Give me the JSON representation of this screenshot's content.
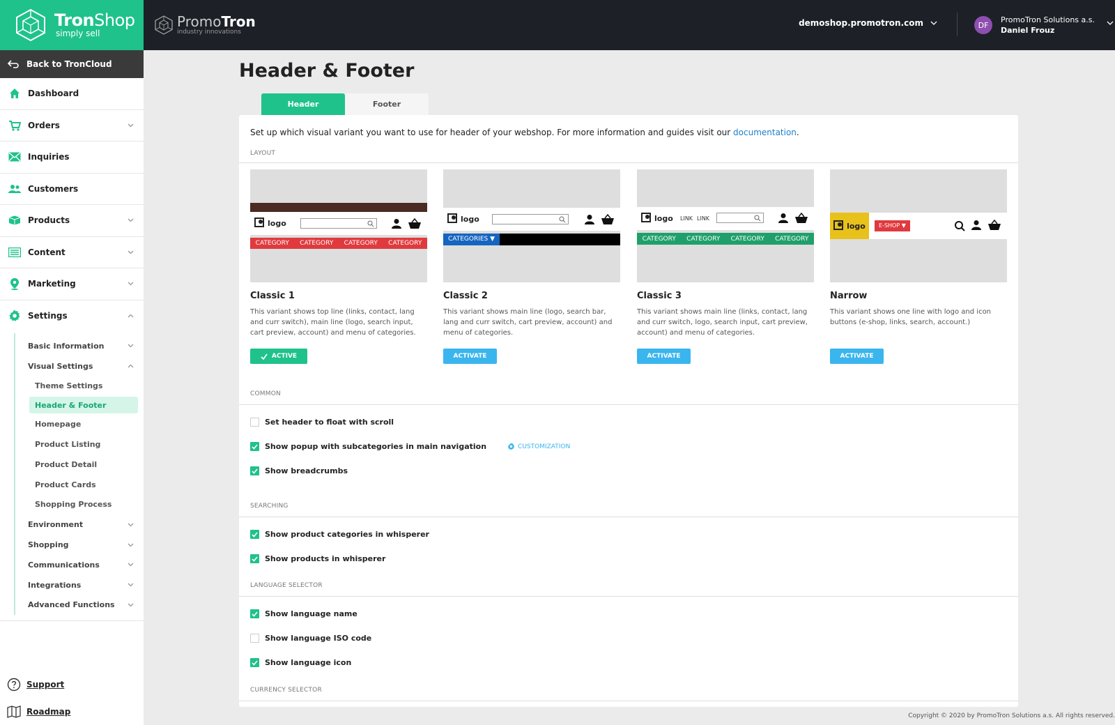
{
  "brand": {
    "name_bold": "Tron",
    "name_rest": "Shop",
    "tagline": "simply sell"
  },
  "back": {
    "label": "Back to TronCloud"
  },
  "nav": [
    {
      "label": "Dashboard",
      "icon": "home-icon",
      "has_chevron": false
    },
    {
      "label": "Orders",
      "icon": "cart-icon",
      "has_chevron": true
    },
    {
      "label": "Inquiries",
      "icon": "mail-icon",
      "has_chevron": false
    },
    {
      "label": "Customers",
      "icon": "users-icon",
      "has_chevron": false
    },
    {
      "label": "Products",
      "icon": "box-icon",
      "has_chevron": true
    },
    {
      "label": "Content",
      "icon": "list-icon",
      "has_chevron": true
    },
    {
      "label": "Marketing",
      "icon": "pin-icon",
      "has_chevron": true
    },
    {
      "label": "Settings",
      "icon": "gear-icon",
      "has_chevron": true,
      "expanded": true
    }
  ],
  "settings_sub": {
    "basic_information": "Basic Information",
    "visual_settings": "Visual Settings",
    "visual_children": [
      "Theme Settings",
      "Header & Footer",
      "Homepage",
      "Product Listing",
      "Product Detail",
      "Product Cards",
      "Shopping Process"
    ],
    "active_child": "Header & Footer",
    "rest": [
      "Environment",
      "Shopping",
      "Communications",
      "Integrations",
      "Advanced Functions"
    ]
  },
  "bottom_links": {
    "support": "Support",
    "roadmap": "Roadmap"
  },
  "topbar": {
    "promo_name_light": "Promo",
    "promo_name_bold": "Tron",
    "promo_tagline": "industry innovations",
    "domain": "demoshop.promotron.com",
    "user_initials": "DF",
    "user_company": "PromoTron Solutions a.s.",
    "user_name": "Daniel Frouz"
  },
  "page": {
    "title": "Header & Footer",
    "tabs": [
      "Header",
      "Footer"
    ],
    "active_tab": "Header",
    "intro": "Set up which visual variant you want to use for header of your webshop. For more information and guides visit our ",
    "intro_link": "documentation",
    "intro_end": "."
  },
  "sections": {
    "layout": "LAYOUT",
    "common": "COMMON",
    "searching": "SEARCHING",
    "language_selector": "LANGUAGE SELECTOR",
    "currency_selector": "CURRENCY SELECTOR"
  },
  "preview_text": {
    "logo": "logo",
    "category": "CATEGORY",
    "categories_dropdown": "CATEGORIES ▼",
    "link": "LINK",
    "eshop": "E-SHOP ▼"
  },
  "variants": [
    {
      "name": "Classic 1",
      "desc": "This variant shows top line (links, contact, lang and curr switch), main line (logo, search input, cart preview, account) and menu of categories.",
      "button": "ACTIVE",
      "active": true
    },
    {
      "name": "Classic 2",
      "desc": "This variant shows main line (logo, search bar, lang and curr switch, cart preview, account) and menu of categories.",
      "button": "ACTIVATE",
      "active": false
    },
    {
      "name": "Classic 3",
      "desc": "This variant shows main line (links, contact, lang and curr switch, logo, search input, cart preview, account) and menu of categories.",
      "button": "ACTIVATE",
      "active": false
    },
    {
      "name": "Narrow",
      "desc": "This variant shows one line with logo and icon buttons (e-shop, links, search, account.)",
      "button": "ACTIVATE",
      "active": false
    }
  ],
  "options": {
    "common": [
      {
        "label": "Set header to float with scroll",
        "checked": false
      },
      {
        "label": "Show popup with subcategories in main navigation",
        "checked": true,
        "extra": "CUSTOMIZATION"
      },
      {
        "label": "Show breadcrumbs",
        "checked": true
      }
    ],
    "searching": [
      {
        "label": "Show product categories in whisperer",
        "checked": true
      },
      {
        "label": "Show products in whisperer",
        "checked": true
      }
    ],
    "language": [
      {
        "label": "Show language name",
        "checked": true
      },
      {
        "label": "Show language ISO code",
        "checked": false
      },
      {
        "label": "Show language icon",
        "checked": true
      }
    ]
  },
  "colors": {
    "accent": "#1fc28a",
    "blue": "#3ab5ee",
    "topbar": "#1d2127",
    "red": "#e03a3e",
    "classic2_blue": "#1565c0",
    "yellow": "#e8c11a",
    "brown": "#4a2a22"
  },
  "footer": {
    "copyright": "Copyright © 2020 by PromoTron Solutions a.s. All rights reserved."
  }
}
